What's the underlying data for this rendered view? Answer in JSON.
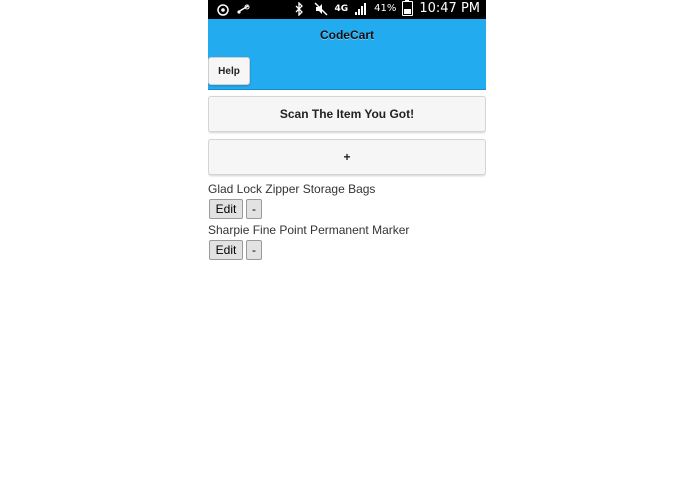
{
  "status_bar": {
    "network": "4G",
    "battery_percent": "41%",
    "time": "10:47 PM"
  },
  "header": {
    "title": "CodeCart",
    "help_label": "Help"
  },
  "actions": {
    "scan_label": "Scan The Item You Got!",
    "add_label": "+"
  },
  "items": [
    {
      "name": "Glad Lock Zipper Storage Bags",
      "edit_label": "Edit",
      "remove_label": "-"
    },
    {
      "name": "Sharpie Fine Point Permanent Marker",
      "edit_label": "Edit",
      "remove_label": "-"
    }
  ],
  "colors": {
    "header_bg": "#23abf0",
    "status_bg": "#000000"
  }
}
